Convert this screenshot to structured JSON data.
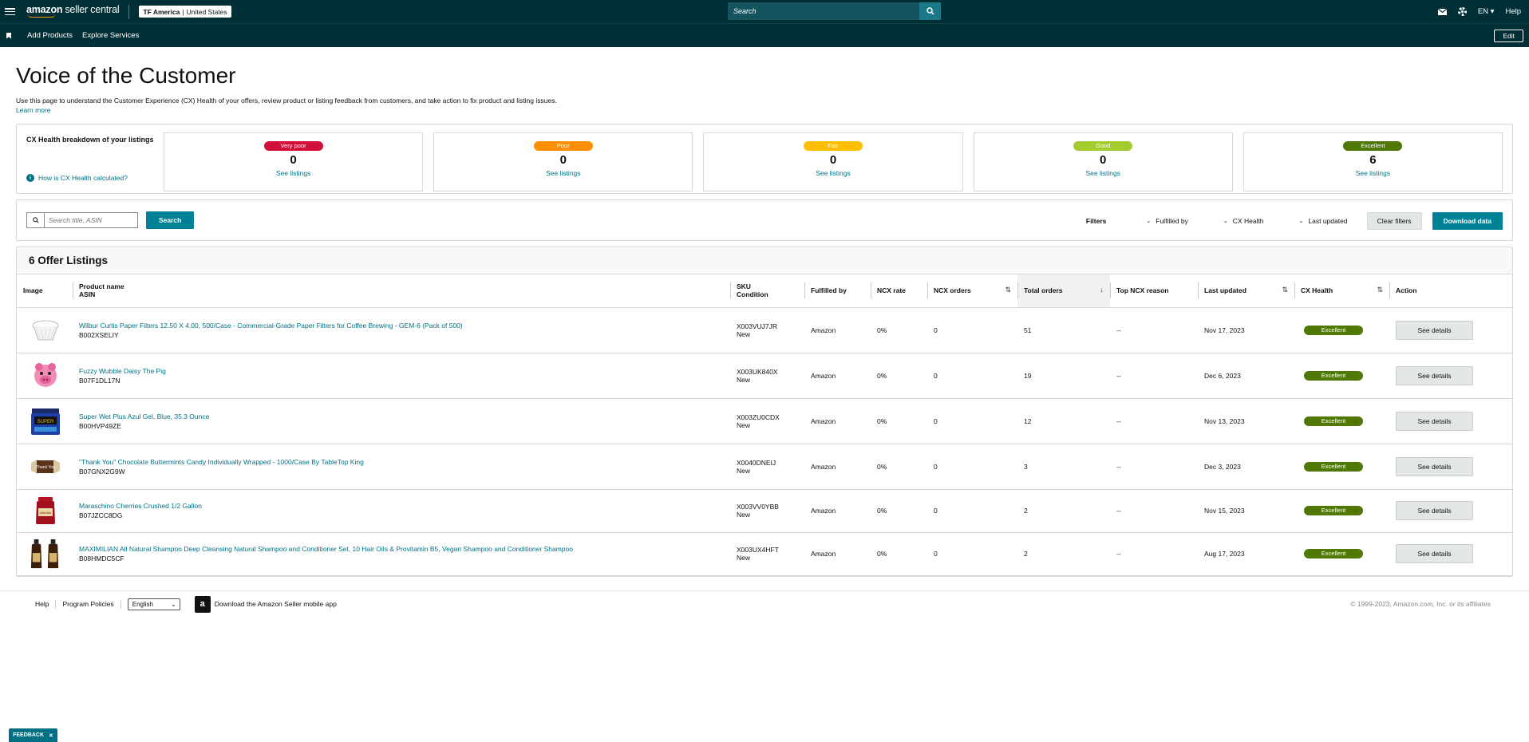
{
  "topbar": {
    "logo_main": "amazon",
    "logo_sub": "seller central",
    "store_name": "TF America",
    "store_region": "United States",
    "search_placeholder": "Search",
    "language": "EN",
    "help": "Help"
  },
  "subnav": {
    "links": [
      "Add Products",
      "Explore Services"
    ],
    "edit_label": "Edit"
  },
  "page": {
    "title": "Voice of the Customer",
    "intro": "Use this page to understand the Customer Experience (CX) Health of your offers, review product or listing feedback from customers, and take action to fix product and listing issues.",
    "learn_more": "Learn more"
  },
  "health": {
    "heading": "CX Health breakdown of your listings",
    "how_link": "How is CX Health calculated?",
    "cards": [
      {
        "label": "Very poor",
        "count": "0",
        "link": "See listings",
        "color": "#d0103a"
      },
      {
        "label": "Poor",
        "count": "0",
        "link": "See listings",
        "color": "#ff8f00"
      },
      {
        "label": "Fair",
        "count": "0",
        "link": "See listings",
        "color": "#ffbf00"
      },
      {
        "label": "Good",
        "count": "0",
        "link": "See listings",
        "color": "#a4cc2e"
      },
      {
        "label": "Excellent",
        "count": "6",
        "link": "See listings",
        "color": "#4f7805"
      }
    ]
  },
  "filter_bar": {
    "search_placeholder": "Search title, ASIN",
    "search_button": "Search",
    "filters_label": "Filters",
    "dropdowns": [
      "Fulfilled by",
      "CX Health",
      "Last updated"
    ],
    "clear_button": "Clear filters",
    "download_button": "Download data"
  },
  "table": {
    "title": "6 Offer Listings",
    "headers": {
      "image": "Image",
      "product": "Product name",
      "product_sub": "ASIN",
      "sku": "SKU",
      "sku_sub": "Condition",
      "fulfilled": "Fulfilled by",
      "ncx_rate": "NCX rate",
      "ncx_orders": "NCX orders",
      "total_orders": "Total orders",
      "top_reason": "Top NCX reason",
      "last_updated": "Last updated",
      "cx_health": "CX Health",
      "action": "Action"
    },
    "rows": [
      {
        "name": "Wilbur Curtis Paper Filters 12.50 X 4.00, 500/Case - Commercial-Grade Paper Filters for Coffee Brewing - GEM-6 (Pack of 500)",
        "asin": "B002XSELIY",
        "sku": "X003VUJ7JR",
        "condition": "New",
        "fulfilled": "Amazon",
        "ncx_rate": "0%",
        "ncx_orders": "0",
        "total_orders": "51",
        "reason": "--",
        "updated": "Nov 17, 2023",
        "health": "Excellent",
        "action": "See details",
        "img": "filter"
      },
      {
        "name": "Fuzzy Wubble Daisy The Pig",
        "asin": "B07F1DL17N",
        "sku": "X003UK840X",
        "condition": "New",
        "fulfilled": "Amazon",
        "ncx_rate": "0%",
        "ncx_orders": "0",
        "total_orders": "19",
        "reason": "--",
        "updated": "Dec 6, 2023",
        "health": "Excellent",
        "action": "See details",
        "img": "pig"
      },
      {
        "name": "Super Wet Plus Azul Gel, Blue, 35.3 Ounce",
        "asin": "B00HVP49ZE",
        "sku": "X003ZU0CDX",
        "condition": "New",
        "fulfilled": "Amazon",
        "ncx_rate": "0%",
        "ncx_orders": "0",
        "total_orders": "12",
        "reason": "--",
        "updated": "Nov 13, 2023",
        "health": "Excellent",
        "action": "See details",
        "img": "gel"
      },
      {
        "name": "\"Thank You\" Chocolate Buttermints Candy Individually Wrapped - 1000/Case By TableTop King",
        "asin": "B07GNX2G9W",
        "sku": "X0040DNEIJ",
        "condition": "New",
        "fulfilled": "Amazon",
        "ncx_rate": "0%",
        "ncx_orders": "0",
        "total_orders": "3",
        "reason": "--",
        "updated": "Dec 3, 2023",
        "health": "Excellent",
        "action": "See details",
        "img": "candy"
      },
      {
        "name": "Maraschino Cherries Crushed 1/2 Gallon",
        "asin": "B07JZCC8DG",
        "sku": "X003VV0YBB",
        "condition": "New",
        "fulfilled": "Amazon",
        "ncx_rate": "0%",
        "ncx_orders": "0",
        "total_orders": "2",
        "reason": "--",
        "updated": "Nov 15, 2023",
        "health": "Excellent",
        "action": "See details",
        "img": "cherry"
      },
      {
        "name": "MAXIMILIAN All Natural Shampoo Deep Cleansing Natural Shampoo and Conditioner Set, 10 Hair Oils & Provitamin B5, Vegan Shampoo and Conditioner Shampoo",
        "asin": "B08HMDC5CF",
        "sku": "X003UX4HFT",
        "condition": "New",
        "fulfilled": "Amazon",
        "ncx_rate": "0%",
        "ncx_orders": "0",
        "total_orders": "2",
        "reason": "--",
        "updated": "Aug 17, 2023",
        "health": "Excellent",
        "action": "See details",
        "img": "shampoo"
      }
    ]
  },
  "footer": {
    "links": [
      "Help",
      "Program Policies"
    ],
    "language": "English",
    "app_text": "Download the Amazon Seller mobile app",
    "copyright": "© 1999-2023, Amazon.com, Inc. or its affiliates"
  },
  "feedback": "FEEDBACK",
  "colors": {
    "header": "#002f36",
    "accent": "#008296",
    "link": "#007185",
    "excellent": "#4f7805"
  }
}
